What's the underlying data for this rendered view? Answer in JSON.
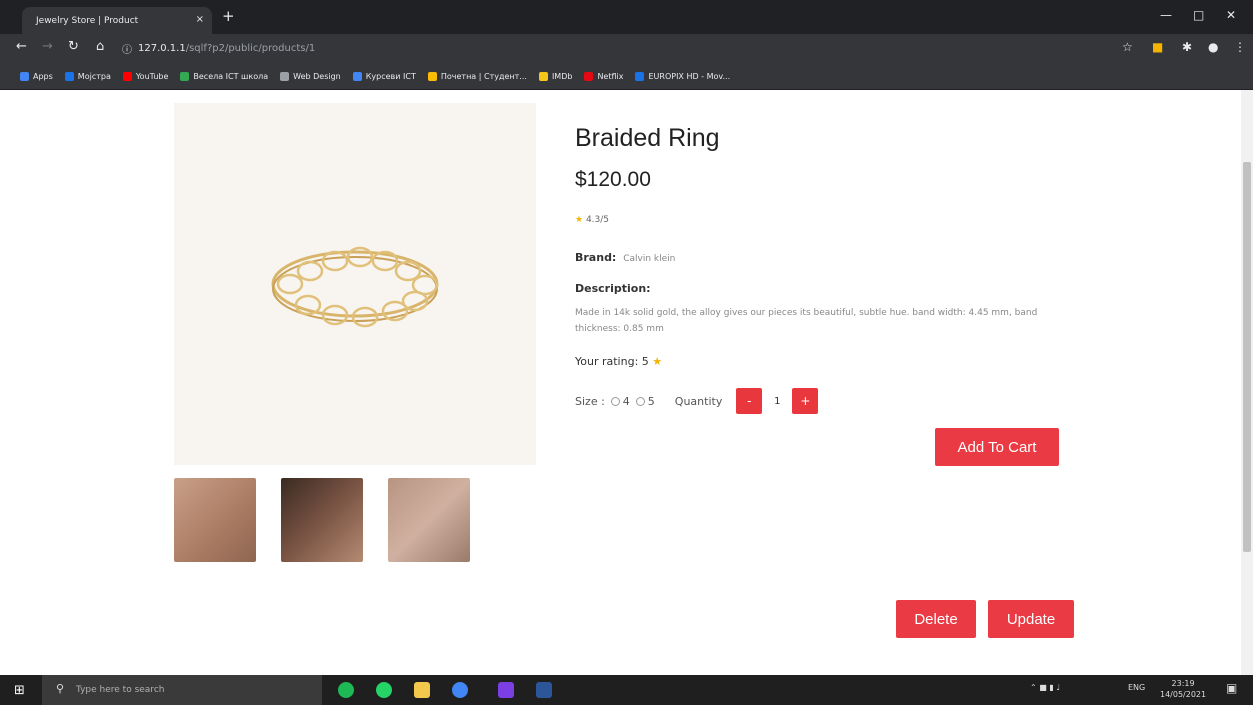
{
  "browser": {
    "tab_title": "Jewelry Store | Product",
    "tab_close": "×",
    "new_tab": "+",
    "url_host": "127.0.1.1",
    "url_path": "/sqlf?p2/public/products/1",
    "bookmarks": [
      {
        "label": "Apps",
        "color": "#4285f4"
      },
      {
        "label": "Мојстра",
        "color": "#1a73e8"
      },
      {
        "label": "YouTube",
        "color": "#ff0000"
      },
      {
        "label": "Весела ICT школа",
        "color": "#34a853"
      },
      {
        "label": "Web Design",
        "color": "#9aa0a6"
      },
      {
        "label": "Курсеви ICT",
        "color": "#4285f4"
      },
      {
        "label": "Почетна | Студент...",
        "color": "#fbbc05"
      },
      {
        "label": "IMDb",
        "color": "#f5c518"
      },
      {
        "label": "Netflix",
        "color": "#e50914"
      },
      {
        "label": "EUROPIX HD - Mov...",
        "color": "#1a73e8"
      }
    ]
  },
  "product": {
    "title": "Braided Ring",
    "price": "$120.00",
    "rating": "4.3/5",
    "brand_label": "Brand:",
    "brand_value": "Calvin klein",
    "description_label": "Description:",
    "description": "Made in 14k solid gold, the alloy gives our pieces its beautiful, subtle hue. band width: 4.45 mm, band thickness: 0.85 mm",
    "your_rating_label": "Your rating: 5",
    "size_label": "Size :",
    "size_options": [
      "4",
      "5"
    ],
    "quantity_label": "Quantity",
    "quantity_value": "1",
    "minus": "-",
    "plus": "+",
    "add_to_cart": "Add To Cart",
    "delete": "Delete",
    "update": "Update"
  },
  "taskbar": {
    "search_placeholder": "Type here to search",
    "time": "23:19",
    "date": "14/05/2021",
    "lang": "ENG"
  },
  "colors": {
    "accent": "#ea3a43",
    "star": "#f4b400"
  }
}
